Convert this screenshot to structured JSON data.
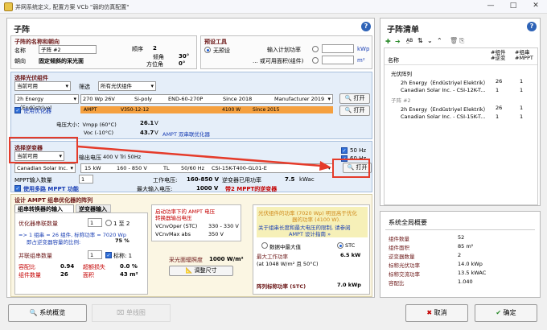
{
  "window": {
    "title": "并网系统定义, 配置方案 VCb \"弱的仿真配置\""
  },
  "left": {
    "title": "子阵",
    "name_section": {
      "title": "子阵的名称和朝向",
      "name_label": "名称",
      "name_value": "子阵 #2",
      "orient_label": "朝向",
      "orient_value": "固定倾斜的采光面",
      "order_label": "顺序",
      "order_value": "2",
      "tilt_label": "倾角",
      "tilt_value": "30°",
      "azimuth_label": "方位角",
      "azimuth_value": "0°"
    },
    "sizing": {
      "title": "预设工具",
      "no_sizing": "无预设",
      "planned_power_label": "输入计划功率",
      "planned_power_unit": "kWp",
      "area_label": "... 或可用面积(组件)",
      "area_unit": "m²"
    },
    "module": {
      "title": "选择光伏组件",
      "filter_value": "当前可用",
      "filter_label": "筛选",
      "filter_all": "所有光伏组件",
      "manufacturer": "2h Energy（Endüstriyel",
      "power": "270 Wp 26V",
      "tech": "Si-poly",
      "model": "END-60-270P",
      "since": "Since 2018",
      "db": "Manufacturer 2019",
      "open": "打开",
      "use_optimizer": "使用优化器",
      "opt_brand": "AMPT",
      "opt_model": "V350-12-12",
      "opt_power": "4100 W",
      "opt_since": "Since 2015",
      "vmpp_label": "电压大小：Vmpp (60°C)",
      "vmpp_value": "26.1",
      "vmpp_unit": "V",
      "voc_label": "Voc (-10°C)",
      "voc_value": "43.7",
      "voc_unit": "V",
      "voc_note": "AMPT 双串联优化器"
    },
    "inverter": {
      "title": "选择逆变器",
      "filter_value": "当前可用",
      "output_label": "输出电压",
      "output_value": "400 V Tri 50Hz",
      "hz50": "50 Hz",
      "hz60": "60 Hz",
      "brand": "Canadian Solar Inc.",
      "power": "15 kW",
      "vrange": "160 - 850 V",
      "tl": "TL",
      "freq": "50/60 Hz",
      "model": "CSI-15K-T400-GL01-E",
      "open": "打开",
      "mppt_label": "MPPT输入数量",
      "mppt_value": "1",
      "op_v_label": "工作电压:",
      "op_v_value": "160-850 V",
      "inv_used_label": "逆变器已用功率",
      "inv_used_value": "7.5",
      "inv_used_unit": "kWac",
      "max_in_label": "最大输入电压:",
      "max_in_value": "1000 V",
      "multi_mppt": "使用多路 MPPT 功能",
      "two_mppt_note": "带2 MPPT的逆变器"
    },
    "design": {
      "title": "设计 AMPT 组串优化器的阵列",
      "tab1": "组串转换器的输入",
      "tab2": "逆变器输入",
      "series_label": "优化器串联数量",
      "series_value": "1",
      "series_range": "1 至 2",
      "note1": "=> 1 组串 = 26 组件, 标称功率 = 7020 Wp",
      "note2": "即占逆变器容量的比例:",
      "note2_val": "75 %",
      "par_label": "并联组串数量",
      "par_value": "1",
      "mark_label": "标称: 1",
      "ratio_label": "容配比",
      "ratio_value": "0.94",
      "loss_label": "超额损失",
      "loss_value": "0.0 %",
      "mod_count_label": "组件数量",
      "mod_count_value": "26",
      "area_label": "面积",
      "area_value": "43 m²"
    },
    "optbox": {
      "title": "启动功率下的 AMPT 电压",
      "sub": "转换器输出电压",
      "vcnvoper_label": "VCnvOper (STC)",
      "vcnvoper_value": "330 - 330 V",
      "vcnvmax_label": "VCnvMax abs",
      "vcnvmax_value": "350 V",
      "irr_label": "采光面辐照度",
      "irr_value": "1000 W/m²",
      "resize": "调整尺寸"
    },
    "warn": {
      "line1": "光伏组件的功率 (7020 Wp) 明显高于优化",
      "line2": "器的功率 (4100 W).",
      "line3": "关于组串长度和最大电压的限制, 请参阅",
      "line4": "AMPT 设计指南 »",
      "max_label": "数据中最大值",
      "stc": "STC",
      "max_p_label": "最大工作功率",
      "max_p_value": "6.5 kW",
      "max_p_note": "(at 1048 W/m² 且 50°C)",
      "nominal_label": "阵列标称功率 (STC)",
      "nominal_value": "7.0 kWp"
    }
  },
  "right": {
    "title": "子阵清单",
    "col_name": "名称",
    "col_inv": "#组件\n#逆变",
    "col_mppt": "#组串\n#MPPT",
    "tree": [
      {
        "label": "光伏阵列",
        "a": "",
        "b": ""
      },
      {
        "label": "2h Energy（Endüstriyel Elektrik）",
        "a": "26",
        "b": "1"
      },
      {
        "label": "Canadian Solar Inc. - CSI-12K-T...",
        "a": "1",
        "b": "1"
      },
      {
        "label": "子阵 #2",
        "a": "",
        "b": ""
      },
      {
        "label": "2h Energy（Endüstriyel Elektrik）",
        "a": "26",
        "b": "1"
      },
      {
        "label": "Canadian Solar Inc. - CSI-15K-T...",
        "a": "1",
        "b": "1"
      }
    ],
    "summary": {
      "title": "系统全局概要",
      "rows": [
        {
          "k": "组件数量",
          "v": "52"
        },
        {
          "k": "组件面积",
          "v": "85 m²"
        },
        {
          "k": "逆变器数量",
          "v": "2"
        },
        {
          "k": "标称光伏功率",
          "v": "14.0 kWp"
        },
        {
          "k": "标称交流功率",
          "v": "13.5 kWAC"
        },
        {
          "k": "容配比",
          "v": "1.040"
        }
      ]
    }
  },
  "footer": {
    "overview": "系统概览",
    "single_line": "单线图",
    "cancel": "取消",
    "ok": "确定"
  },
  "colors": {
    "accent_red": "#e53b2a",
    "blue": "#2e63b7"
  }
}
